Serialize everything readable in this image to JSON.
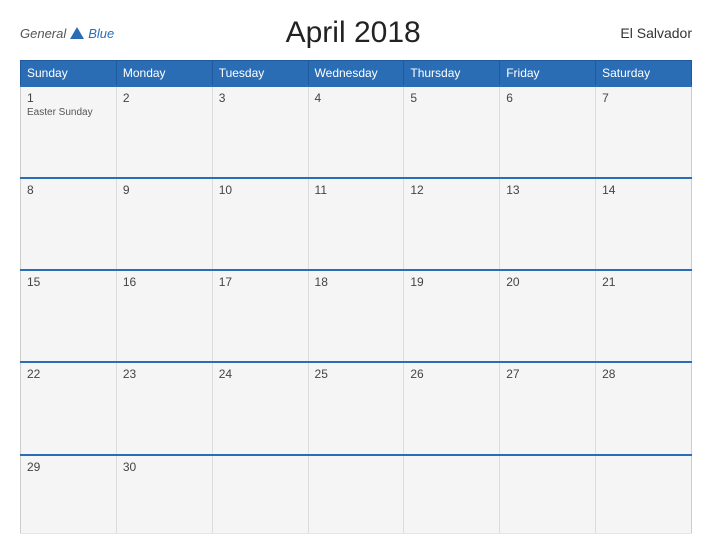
{
  "logo": {
    "general": "General",
    "blue": "Blue"
  },
  "title": "April 2018",
  "country": "El Salvador",
  "weekdays": [
    "Sunday",
    "Monday",
    "Tuesday",
    "Wednesday",
    "Thursday",
    "Friday",
    "Saturday"
  ],
  "weeks": [
    [
      {
        "day": "1",
        "holiday": "Easter Sunday"
      },
      {
        "day": "2",
        "holiday": ""
      },
      {
        "day": "3",
        "holiday": ""
      },
      {
        "day": "4",
        "holiday": ""
      },
      {
        "day": "5",
        "holiday": ""
      },
      {
        "day": "6",
        "holiday": ""
      },
      {
        "day": "7",
        "holiday": ""
      }
    ],
    [
      {
        "day": "8",
        "holiday": ""
      },
      {
        "day": "9",
        "holiday": ""
      },
      {
        "day": "10",
        "holiday": ""
      },
      {
        "day": "11",
        "holiday": ""
      },
      {
        "day": "12",
        "holiday": ""
      },
      {
        "day": "13",
        "holiday": ""
      },
      {
        "day": "14",
        "holiday": ""
      }
    ],
    [
      {
        "day": "15",
        "holiday": ""
      },
      {
        "day": "16",
        "holiday": ""
      },
      {
        "day": "17",
        "holiday": ""
      },
      {
        "day": "18",
        "holiday": ""
      },
      {
        "day": "19",
        "holiday": ""
      },
      {
        "day": "20",
        "holiday": ""
      },
      {
        "day": "21",
        "holiday": ""
      }
    ],
    [
      {
        "day": "22",
        "holiday": ""
      },
      {
        "day": "23",
        "holiday": ""
      },
      {
        "day": "24",
        "holiday": ""
      },
      {
        "day": "25",
        "holiday": ""
      },
      {
        "day": "26",
        "holiday": ""
      },
      {
        "day": "27",
        "holiday": ""
      },
      {
        "day": "28",
        "holiday": ""
      }
    ],
    [
      {
        "day": "29",
        "holiday": ""
      },
      {
        "day": "30",
        "holiday": ""
      },
      {
        "day": "",
        "holiday": ""
      },
      {
        "day": "",
        "holiday": ""
      },
      {
        "day": "",
        "holiday": ""
      },
      {
        "day": "",
        "holiday": ""
      },
      {
        "day": "",
        "holiday": ""
      }
    ]
  ]
}
